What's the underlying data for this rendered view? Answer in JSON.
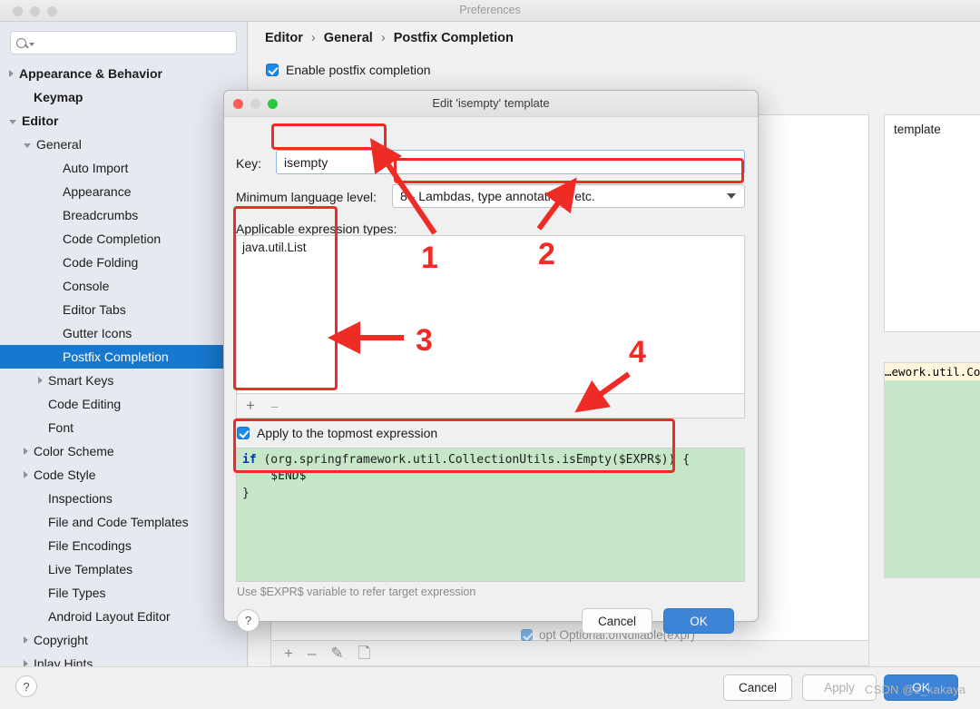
{
  "window": {
    "title": "Preferences",
    "traffic_lights": [
      "close",
      "minimize",
      "zoom"
    ]
  },
  "search": {
    "value": "",
    "placeholder": "",
    "icon": "search-icon"
  },
  "sidebar": {
    "items": [
      {
        "label": "Appearance & Behavior",
        "indent": 0,
        "arrow": "right",
        "bold": true,
        "selected": false
      },
      {
        "label": "Keymap",
        "indent": 1,
        "arrow": "none",
        "bold": true,
        "selected": false
      },
      {
        "label": "Editor",
        "indent": 0,
        "arrow": "down",
        "bold": true,
        "selected": false
      },
      {
        "label": "General",
        "indent": 1,
        "arrow": "down",
        "bold": false,
        "selected": false
      },
      {
        "label": "Auto Import",
        "indent": 3,
        "arrow": "none",
        "bold": false,
        "selected": false
      },
      {
        "label": "Appearance",
        "indent": 3,
        "arrow": "none",
        "bold": false,
        "selected": false
      },
      {
        "label": "Breadcrumbs",
        "indent": 3,
        "arrow": "none",
        "bold": false,
        "selected": false
      },
      {
        "label": "Code Completion",
        "indent": 3,
        "arrow": "none",
        "bold": false,
        "selected": false
      },
      {
        "label": "Code Folding",
        "indent": 3,
        "arrow": "none",
        "bold": false,
        "selected": false
      },
      {
        "label": "Console",
        "indent": 3,
        "arrow": "none",
        "bold": false,
        "selected": false
      },
      {
        "label": "Editor Tabs",
        "indent": 3,
        "arrow": "none",
        "bold": false,
        "selected": false
      },
      {
        "label": "Gutter Icons",
        "indent": 3,
        "arrow": "none",
        "bold": false,
        "selected": false
      },
      {
        "label": "Postfix Completion",
        "indent": 3,
        "arrow": "none",
        "bold": false,
        "selected": true
      },
      {
        "label": "Smart Keys",
        "indent": 2,
        "arrow": "right",
        "bold": false,
        "selected": false
      },
      {
        "label": "Code Editing",
        "indent": 2,
        "arrow": "none",
        "bold": false,
        "selected": false
      },
      {
        "label": "Font",
        "indent": 2,
        "arrow": "none",
        "bold": false,
        "selected": false
      },
      {
        "label": "Color Scheme",
        "indent": 1,
        "arrow": "right",
        "bold": false,
        "selected": false
      },
      {
        "label": "Code Style",
        "indent": 1,
        "arrow": "right",
        "bold": false,
        "selected": false
      },
      {
        "label": "Inspections",
        "indent": 2,
        "arrow": "none",
        "bold": false,
        "selected": false
      },
      {
        "label": "File and Code Templates",
        "indent": 2,
        "arrow": "none",
        "bold": false,
        "selected": false
      },
      {
        "label": "File Encodings",
        "indent": 2,
        "arrow": "none",
        "bold": false,
        "selected": false
      },
      {
        "label": "Live Templates",
        "indent": 2,
        "arrow": "none",
        "bold": false,
        "selected": false
      },
      {
        "label": "File Types",
        "indent": 2,
        "arrow": "none",
        "bold": false,
        "selected": false
      },
      {
        "label": "Android Layout Editor",
        "indent": 2,
        "arrow": "none",
        "bold": false,
        "selected": false
      },
      {
        "label": "Copyright",
        "indent": 1,
        "arrow": "right",
        "bold": false,
        "selected": false
      },
      {
        "label": "Inlay Hints",
        "indent": 1,
        "arrow": "right",
        "bold": false,
        "selected": false
      }
    ]
  },
  "content": {
    "breadcrumb": {
      "root": "Editor",
      "mid": "General",
      "leaf": "Postfix Completion",
      "separator": "›"
    },
    "enable_postfix": {
      "label": "Enable postfix completion",
      "checked": true
    },
    "preview_top_text": "template",
    "preview_code_line": "…ework.util.CollectionUtils.isE",
    "list_toolbar": [
      "add-icon",
      "remove-icon",
      "edit-icon",
      "duplicate-icon"
    ],
    "ghost_row": "opt  Optional.ofNullable(expr)"
  },
  "dialog": {
    "title": "Edit 'isempty' template",
    "key": {
      "label": "Key:",
      "value": "isempty"
    },
    "min_language_level": {
      "label": "Minimum language level:",
      "value": "8 - Lambdas, type annotations etc."
    },
    "applicable_expression_types": {
      "label": "Applicable expression types:",
      "items": [
        "java.util.List"
      ],
      "toolbar": [
        "add-icon",
        "remove-icon"
      ]
    },
    "apply_topmost": {
      "label": "Apply to the topmost expression",
      "checked": true
    },
    "template_code": {
      "keyword": "if",
      "line1_rest": " (org.springframework.util.CollectionUtils.isEmpty($EXPR$)) {",
      "line2": "    $END$",
      "line3": "}"
    },
    "hint": "Use $EXPR$ variable to refer target expression",
    "help_label": "?",
    "cancel_label": "Cancel",
    "ok_label": "OK"
  },
  "bottom_bar": {
    "help_label": "?",
    "cancel_label": "Cancel",
    "apply_label": "Apply",
    "ok_label": "OK"
  },
  "annotations": {
    "numbers": [
      "1",
      "2",
      "3",
      "4"
    ],
    "color": "#ef2b25"
  },
  "watermark": "CSDN @z_kakaya",
  "colors": {
    "accent_blue": "#1778d0",
    "dialog_ok_blue": "#3d84d6",
    "code_green": "#c6e7c8",
    "annotation_red": "#ef2b25",
    "highlight_yellow": "#fdf6dd"
  }
}
